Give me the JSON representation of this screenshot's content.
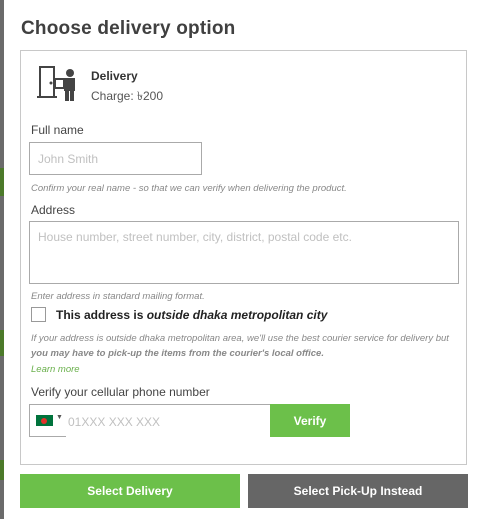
{
  "modal": {
    "title": "Choose delivery option"
  },
  "delivery": {
    "icon": "delivery-person-icon",
    "title": "Delivery",
    "charge": "Charge: ৳200"
  },
  "form": {
    "full_name": {
      "label": "Full name",
      "placeholder": "John Smith",
      "help": "Confirm your real name - so that we can verify when delivering the product."
    },
    "address": {
      "label": "Address",
      "placeholder": "House number, street number, city, district, postal code etc.",
      "help": "Enter address in standard mailing format."
    },
    "outside_dhaka": {
      "label_prefix": "This address is ",
      "label_emphasis": "outside dhaka metropolitan city",
      "help_normal": "If your address is outside dhaka metropolitan area, we'll use the best courier service for delivery but ",
      "help_bold": "you may have to pick-up the items from the courier's local office.",
      "learn_more": "Learn more"
    },
    "phone": {
      "label": "Verify your cellular phone number",
      "placeholder": "01XXX XXX XXX",
      "country_flag": "bangladesh-flag-icon",
      "verify_label": "Verify"
    }
  },
  "actions": {
    "select_delivery": "Select Delivery",
    "select_pickup": "Select Pick-Up Instead"
  },
  "colors": {
    "accent_green": "#6cc04a",
    "secondary_gray": "#666666",
    "backdrop": "#5a5a5a"
  }
}
